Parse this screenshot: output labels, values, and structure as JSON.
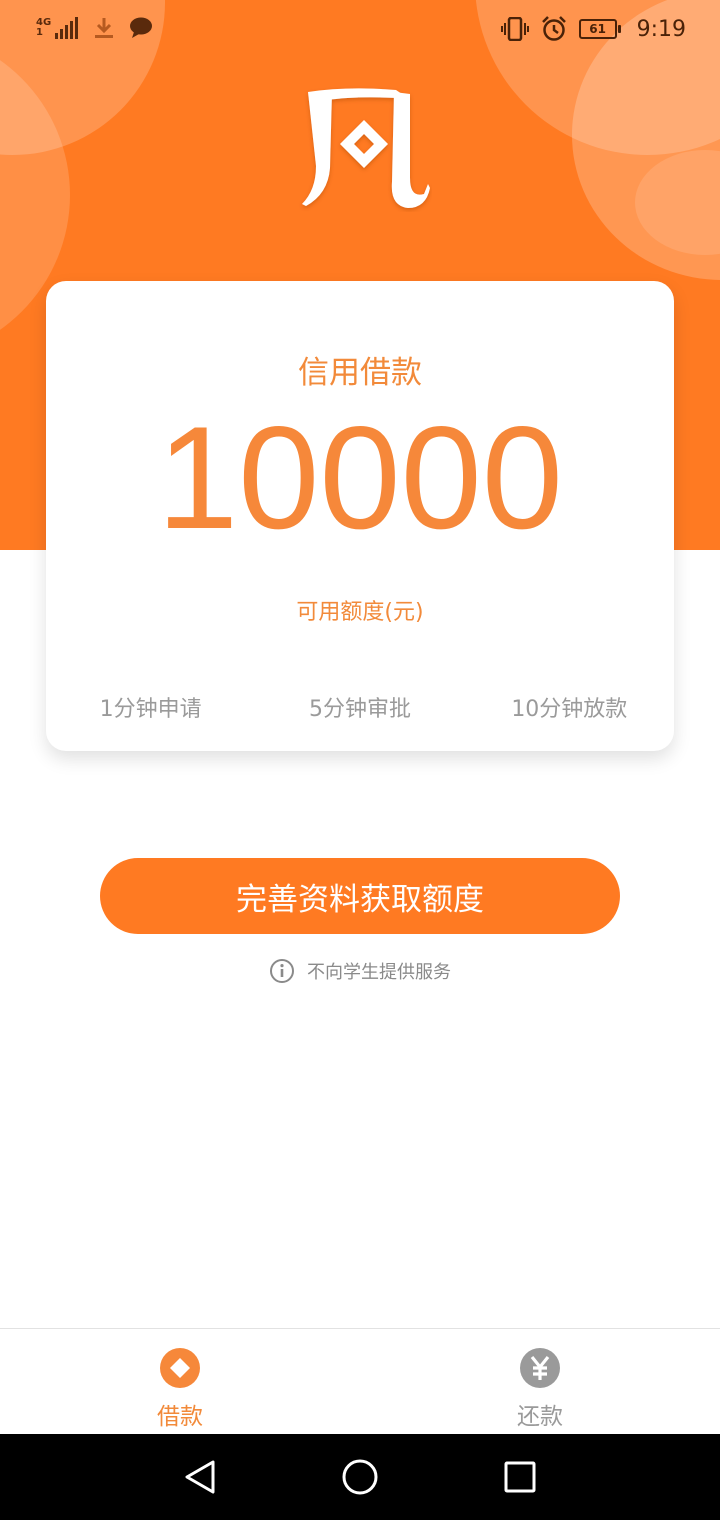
{
  "status_bar": {
    "network_top": "4G",
    "network_bottom": "1",
    "battery": "61",
    "time": "9:19"
  },
  "colors": {
    "brand_orange": "#ff7a22",
    "accent_text": "#f28a3a",
    "muted_text": "#9a9a9a"
  },
  "card": {
    "title": "信用借款",
    "amount": "10000",
    "subtitle": "可用额度(元)",
    "steps": [
      "1分钟申请",
      "5分钟审批",
      "10分钟放款"
    ]
  },
  "cta": {
    "label": "完善资料获取额度"
  },
  "notice": {
    "text": "不向学生提供服务",
    "icon": "info-icon"
  },
  "tabbar": {
    "items": [
      {
        "label": "借款",
        "icon": "loan-diamond-icon",
        "active": true
      },
      {
        "label": "还款",
        "icon": "yen-icon",
        "active": false
      }
    ]
  },
  "system_nav": {
    "icons": [
      "back-triangle-icon",
      "home-circle-icon",
      "recents-square-icon"
    ]
  }
}
